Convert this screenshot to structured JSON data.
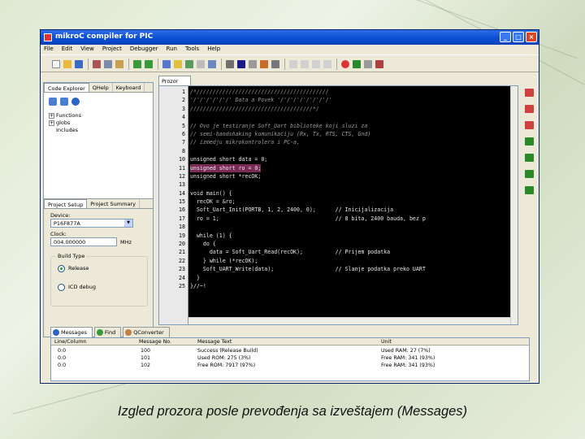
{
  "window": {
    "title": "mikroC compiler for PIC",
    "controls": [
      "minimize-icon",
      "maximize-icon",
      "close-icon"
    ]
  },
  "menu": [
    "File",
    "Edit",
    "View",
    "Project",
    "Debugger",
    "Run",
    "Tools",
    "Help"
  ],
  "left_panel": {
    "tabs": [
      "Code Explorer",
      "QHelp",
      "Keyboard"
    ],
    "tree": [
      "Functions",
      "globs",
      "Includes"
    ],
    "setup_tabs": [
      "Project Setup",
      "Project Summary"
    ],
    "device_label": "Device:",
    "device_value": "P16F877A",
    "clock_label": "Clock:",
    "clock_value": "004.000000",
    "clock_unit": "MHz",
    "build_type_label": "Build Type",
    "build_release": "Release",
    "build_debug": "ICD debug"
  },
  "editor": {
    "tab": "Prozor",
    "lines": [
      {
        "n": "1",
        "t": "/*/////////////////////////////////////////",
        "s": "com"
      },
      {
        "n": "2",
        "t": "'/'/'/'/'/'/' Data a Povek '/'/'/'/'/'/'/'/'",
        "s": "com"
      },
      {
        "n": "3",
        "t": "//////////////////////////////////////*/",
        "s": "com"
      },
      {
        "n": "4",
        "t": "",
        "s": "com"
      },
      {
        "n": "5",
        "t": "// Ovo je testiranje Soft_Uart biblioteke koji sluzi za",
        "s": "com"
      },
      {
        "n": "6",
        "t": "// semi-handshaking komunikaciju (Rx, Tx, RTS, CTS, Gnd)",
        "s": "com"
      },
      {
        "n": "7",
        "t": "// izmedju mikrokontrolera i PC-a.",
        "s": "com"
      },
      {
        "n": "8",
        "t": "",
        "s": "kw"
      },
      {
        "n": "10",
        "t": "unsigned short data = 0;",
        "s": "kw"
      },
      {
        "n": "11",
        "t": "unsigned short ro = 0;",
        "s": "hl"
      },
      {
        "n": "12",
        "t": "unsigned short *recOK;",
        "s": "kw"
      },
      {
        "n": "13",
        "t": "",
        "s": "kw"
      },
      {
        "n": "14",
        "t": "void main() {",
        "s": "kw"
      },
      {
        "n": "15",
        "t": "  recOK = &ro;",
        "s": "kw"
      },
      {
        "n": "16",
        "t": "  Soft_Uart_Init(PORTB, 1, 2, 2400, 0);      // Inicijalizacija",
        "s": "kw"
      },
      {
        "n": "17",
        "t": "  ro = 1;                                    // 8 bita, 2400 bauda, bez p",
        "s": "kw"
      },
      {
        "n": "18",
        "t": "",
        "s": "kw"
      },
      {
        "n": "19",
        "t": "  while (1) {",
        "s": "kw"
      },
      {
        "n": "20",
        "t": "    do {",
        "s": "kw"
      },
      {
        "n": "21",
        "t": "      data = Soft_Uart_Read(recOK);          // Prijem podatka",
        "s": "kw"
      },
      {
        "n": "22",
        "t": "    } while (*recOK);",
        "s": "kw"
      },
      {
        "n": "23",
        "t": "    Soft_UART_Write(data);                   // Slanje podatka preko UART",
        "s": "kw"
      },
      {
        "n": "24",
        "t": "  }",
        "s": "kw"
      },
      {
        "n": "25",
        "t": "}//~!",
        "s": "kw"
      }
    ]
  },
  "messages": {
    "tabs": [
      "Messages",
      "Find",
      "QConverter"
    ],
    "headers": [
      "Line/Column",
      "Message No.",
      "Message Text",
      "Unit"
    ],
    "rows": [
      [
        "0:0",
        "100",
        "Success (Release Build)",
        "Used RAM: 27 (7%)"
      ],
      [
        "0:0",
        "101",
        "Used ROM: 275 (3%)",
        "Free RAM: 341 (93%)"
      ],
      [
        "0:0",
        "102",
        "Free ROM: 7917 (97%)",
        "Free RAM: 341 (93%)"
      ]
    ]
  },
  "caption": "Izgled prozora posle prevođenja sa izveštajem (Messages)",
  "colors": {
    "titlebar": "#0a4cd1",
    "editor_bg": "#000000",
    "comment": "#9a9a9a",
    "number": "#dd0000",
    "highlight": "#7a2b55",
    "background": "#dfe9d2"
  }
}
